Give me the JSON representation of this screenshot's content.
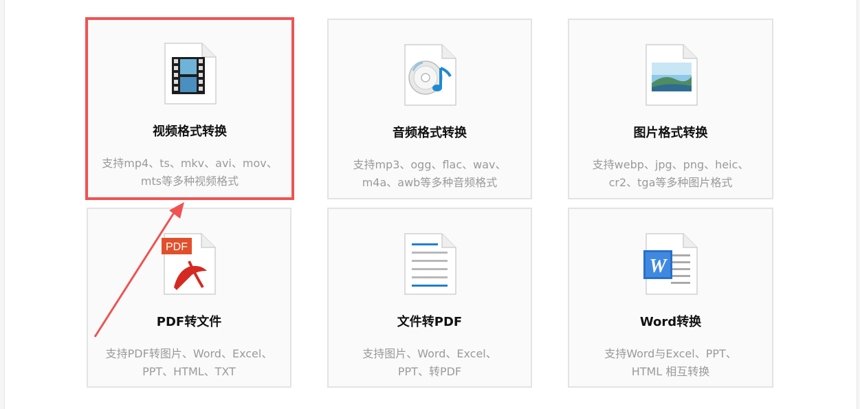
{
  "cards": [
    {
      "title": "视频格式转换",
      "desc_line1": "支持mp4、ts、mkv、avi、mov、",
      "desc_line2": "mts等多种视频格式",
      "icon": "video-file-icon"
    },
    {
      "title": "音频格式转换",
      "desc_line1": "支持mp3、ogg、flac、wav、",
      "desc_line2": "m4a、awb等多种音频格式",
      "icon": "audio-file-icon"
    },
    {
      "title": "图片格式转换",
      "desc_line1": "支持webp、jpg、png、heic、",
      "desc_line2": "cr2、tga等多种图片格式",
      "icon": "image-file-icon"
    },
    {
      "title": "PDF转文件",
      "desc_line1": "支持PDF转图片、Word、Excel、",
      "desc_line2": "PPT、HTML、TXT",
      "icon": "pdf-file-icon",
      "icon_label": "PDF"
    },
    {
      "title": "文件转PDF",
      "desc_line1": "支持图片、Word、Excel、",
      "desc_line2": "PPT、转PDF",
      "icon": "text-file-icon"
    },
    {
      "title": "Word转换",
      "desc_line1": "支持Word与Excel、PPT、",
      "desc_line2": "HTML 相互转换",
      "icon": "word-file-icon",
      "icon_label": "W"
    }
  ],
  "selected_card": 0,
  "colors": {
    "highlight": "#f05252",
    "title": "#111111",
    "desc": "#9a9a9a",
    "card_bg": "#fafafa",
    "card_border": "#e3e3e3"
  }
}
